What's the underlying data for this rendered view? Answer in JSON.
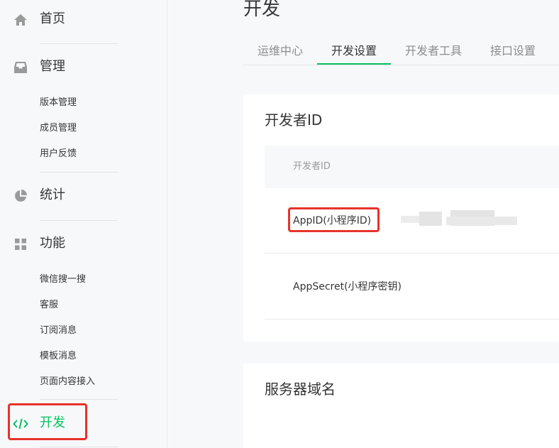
{
  "sidebar": {
    "home": {
      "label": "首页",
      "icon": "home-icon"
    },
    "manage": {
      "label": "管理",
      "icon": "inbox-icon",
      "items": [
        "版本管理",
        "成员管理",
        "用户反馈"
      ]
    },
    "stats": {
      "label": "统计",
      "icon": "pie-chart-icon"
    },
    "features": {
      "label": "功能",
      "icon": "grid-icon",
      "items": [
        "微信搜一搜",
        "客服",
        "订阅消息",
        "模板消息",
        "页面内容接入"
      ]
    },
    "develop": {
      "label": "开发",
      "icon": "code-icon",
      "active": true
    }
  },
  "main": {
    "title": "开发",
    "tabs": [
      "运维中心",
      "开发设置",
      "开发者工具",
      "接口设置"
    ],
    "active_tab": "开发设置",
    "developer_id_card": {
      "title": "开发者ID",
      "table_header": "开发者ID",
      "rows": [
        {
          "label": "AppID(小程序ID)",
          "value": ""
        },
        {
          "label": "AppSecret(小程序密钥)",
          "value": ""
        }
      ]
    },
    "server_domain_card": {
      "title": "服务器域名"
    }
  },
  "colors": {
    "accent": "#07c160",
    "highlight": "#e8322c",
    "text": "#353535",
    "muted": "#8d8d8d",
    "bg": "#f6f8f9"
  }
}
